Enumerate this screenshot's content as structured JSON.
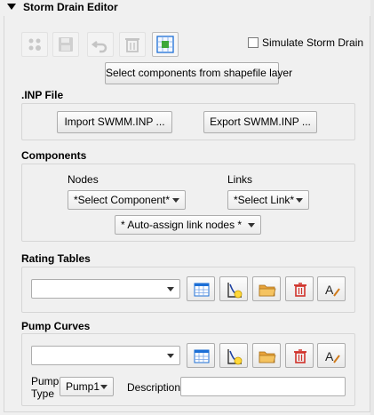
{
  "panel": {
    "title": "Storm Drain Editor"
  },
  "toolbar": {
    "simulate_label": "Simulate Storm Drain",
    "simulate_checked": false,
    "select_components_label": "Select components from shapefile layer",
    "icons": [
      "nodes-icon",
      "save-icon",
      "undo-icon",
      "delete-icon",
      "grid-select-icon"
    ]
  },
  "inp": {
    "title": ".INP File",
    "import_label": "Import SWMM.INP ...",
    "export_label": "Export SWMM.INP ..."
  },
  "components": {
    "title": "Components",
    "nodes_label": "Nodes",
    "links_label": "Links",
    "nodes_combo": "*Select Component*",
    "links_combo": "*Select Link*",
    "auto_assign": "* Auto-assign link nodes *"
  },
  "rating_tables": {
    "title": "Rating Tables",
    "combo_value": ""
  },
  "pump_curves": {
    "title": "Pump Curves",
    "combo_value": "",
    "pump_type_label_1": "Pump",
    "pump_type_label_2": "Type",
    "pump_type_value": "Pump1",
    "description_label": "Description",
    "description_value": ""
  },
  "colors": {
    "accent_blue": "#1c6fd6",
    "delete_red": "#d0322b",
    "folder_orange": "#e8a33a",
    "grid_green": "#3da83a"
  }
}
